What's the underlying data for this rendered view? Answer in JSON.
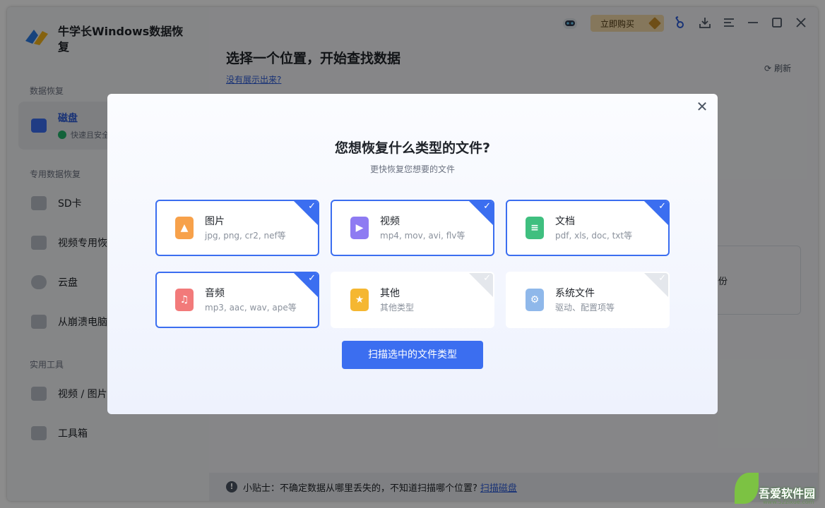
{
  "app": {
    "title": "牛学长Windows数据恢复"
  },
  "sidebar": {
    "sections": [
      {
        "label": "数据恢复"
      },
      {
        "label": "专用数据恢复"
      },
      {
        "label": "实用工具"
      }
    ],
    "items": [
      {
        "label": "磁盘",
        "sub": "快速且安全"
      },
      {
        "label": "SD卡"
      },
      {
        "label": "视频专用恢复"
      },
      {
        "label": "云盘"
      },
      {
        "label": "从崩溃电脑恢复"
      },
      {
        "label": "视频 / 图片修复"
      },
      {
        "label": "工具箱"
      }
    ]
  },
  "titlebar": {
    "buy_label": "立即购买"
  },
  "main": {
    "title": "选择一个位置，开始查找数据",
    "link": "没有展示出来?",
    "refresh": "刷新",
    "bg_card_text": "备份",
    "tip_prefix": "小贴士：不确定数据从哪里丢失的，不知道扫描哪个位置?",
    "tip_link": "扫描磁盘"
  },
  "modal": {
    "title": "您想恢复什么类型的文件?",
    "subtitle": "更快恢复您想要的文件",
    "scan_button": "扫描选中的文件类型",
    "types": [
      {
        "name": "图片",
        "desc": "jpg, png, cr2, nef等",
        "selected": true,
        "color": "#f7a14a"
      },
      {
        "name": "视频",
        "desc": "mp4, mov, avi, flv等",
        "selected": true,
        "color": "#8e7bf2"
      },
      {
        "name": "文档",
        "desc": "pdf, xls, doc, txt等",
        "selected": true,
        "color": "#3fbf7f"
      },
      {
        "name": "音频",
        "desc": "mp3, aac, wav, ape等",
        "selected": true,
        "color": "#f27a7a"
      },
      {
        "name": "其他",
        "desc": "其他类型",
        "selected": false,
        "color": "#f5b731"
      },
      {
        "name": "系统文件",
        "desc": "驱动、配置项等",
        "selected": false,
        "color": "#8fb8ea"
      }
    ]
  },
  "watermark": {
    "text": "吾爱软件园",
    "url": "www.52zixue.com"
  }
}
